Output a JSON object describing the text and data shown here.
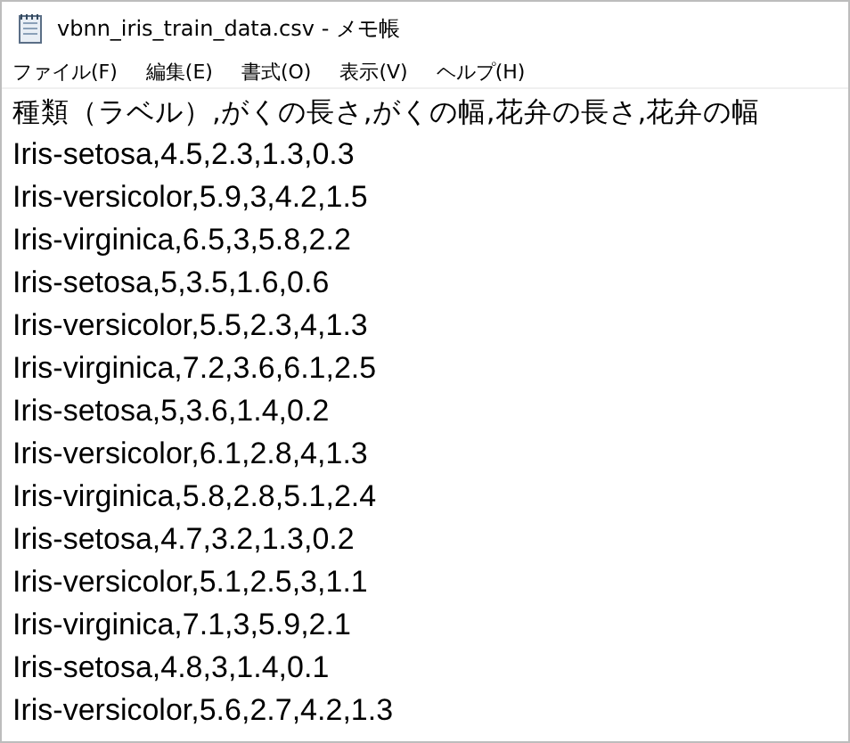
{
  "window": {
    "title": "vbnn_iris_train_data.csv - メモ帳"
  },
  "menu": [
    "ファイル(F)",
    "編集(E)",
    "書式(O)",
    "表示(V)",
    "ヘルプ(H)"
  ],
  "lines": [
    "種類（ラベル）,がくの長さ,がくの幅,花弁の長さ,花弁の幅",
    "Iris-setosa,4.5,2.3,1.3,0.3",
    "Iris-versicolor,5.9,3,4.2,1.5",
    "Iris-virginica,6.5,3,5.8,2.2",
    "Iris-setosa,5,3.5,1.6,0.6",
    "Iris-versicolor,5.5,2.3,4,1.3",
    "Iris-virginica,7.2,3.6,6.1,2.5",
    "Iris-setosa,5,3.6,1.4,0.2",
    "Iris-versicolor,6.1,2.8,4,1.3",
    "Iris-virginica,5.8,2.8,5.1,2.4",
    "Iris-setosa,4.7,3.2,1.3,0.2",
    "Iris-versicolor,5.1,2.5,3,1.1",
    "Iris-virginica,7.1,3,5.9,2.1",
    "Iris-setosa,4.8,3,1.4,0.1",
    "Iris-versicolor,5.6,2.7,4.2,1.3"
  ]
}
